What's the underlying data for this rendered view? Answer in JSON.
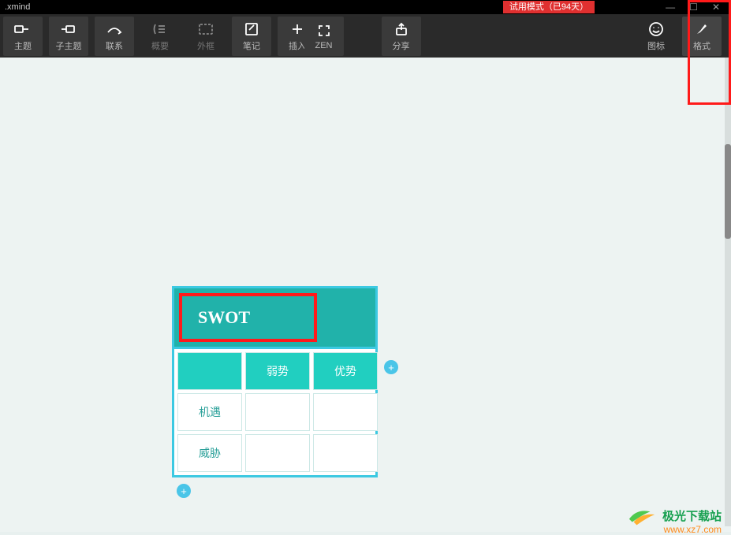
{
  "app": {
    "title": ".xmind"
  },
  "trial": {
    "label": "试用模式（已94天）"
  },
  "toolbar": {
    "topic": "主题",
    "subtopic": "子主题",
    "relation": "联系",
    "summary": "概要",
    "boundary": "外框",
    "notes": "笔记",
    "insert": "插入",
    "zen": "ZEN",
    "share": "分享",
    "icons": "图标",
    "format": "格式"
  },
  "swot": {
    "title": "SWOT",
    "columns": [
      "",
      "弱势",
      "优势"
    ],
    "rows": [
      {
        "label": "机遇",
        "cells": [
          "",
          ""
        ]
      },
      {
        "label": "威胁",
        "cells": [
          "",
          ""
        ]
      }
    ]
  },
  "watermark": {
    "name": "极光下载站",
    "url": "www.xz7.com"
  }
}
